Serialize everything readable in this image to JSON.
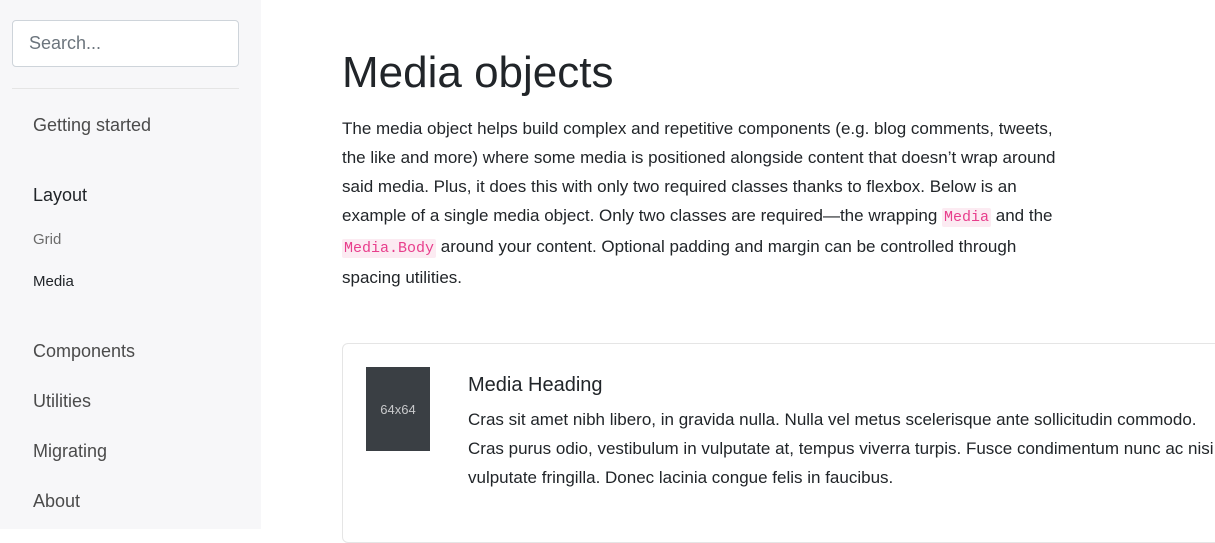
{
  "sidebar": {
    "search_placeholder": "Search...",
    "items": [
      {
        "label": "Getting started"
      },
      {
        "label": "Layout"
      },
      {
        "label": "Grid"
      },
      {
        "label": "Media"
      },
      {
        "label": "Components"
      },
      {
        "label": "Utilities"
      },
      {
        "label": "Migrating"
      },
      {
        "label": "About"
      }
    ],
    "active_item": "Media"
  },
  "main": {
    "title": "Media objects",
    "intro": {
      "text_before": "The media object helps build complex and repetitive components (e.g. blog comments, tweets, the like and more) where some media is positioned alongside content that doesn’t wrap around said media. Plus, it does this with only two required classes thanks to flexbox. Below is an example of a single media object. Only two classes are required—the wrapping ",
      "code1": "Media",
      "text_middle": " and the ",
      "code2": "Media.Body",
      "text_after": " around your content. Optional padding and margin can be controlled through spacing utilities."
    },
    "example": {
      "image_label": "64x64",
      "heading": "Media Heading",
      "body": "Cras sit amet nibh libero, in gravida nulla. Nulla vel metus scelerisque ante sollicitudin commodo. Cras purus odio, vestibulum in vulputate at, tempus viverra turpis. Fusce condimentum nunc ac nisi vulputate fringilla. Donec lacinia congue felis in faucibus."
    }
  },
  "colors": {
    "sidebar_bg": "#f7f7f9",
    "code_text": "#e83e8c",
    "code_bg": "#fcebf2",
    "placeholder_image_bg": "#3a3f44"
  }
}
